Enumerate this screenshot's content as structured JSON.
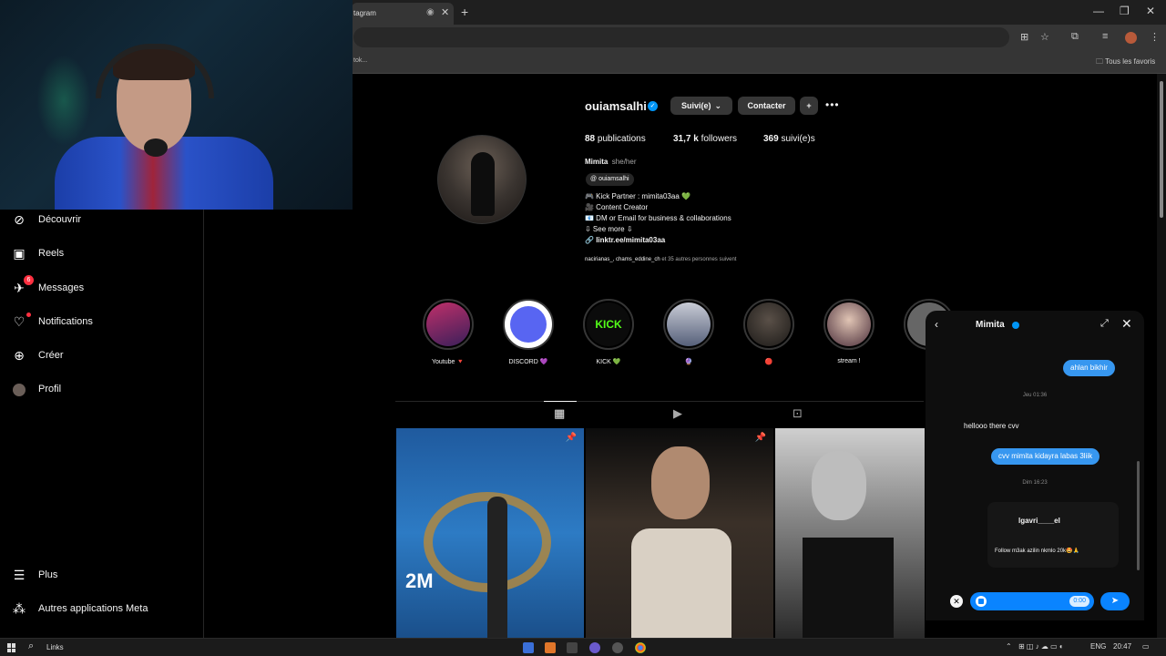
{
  "browser": {
    "tab_title": "tagram",
    "bookmark_left": "tok...",
    "bookmarks_folder": "Tous les favoris"
  },
  "sidebar": {
    "items": [
      {
        "label": "Découvrir",
        "icon": "compass-icon"
      },
      {
        "label": "Reels",
        "icon": "reels-icon"
      },
      {
        "label": "Messages",
        "icon": "messenger-icon",
        "badge": "6"
      },
      {
        "label": "Notifications",
        "icon": "heart-icon"
      },
      {
        "label": "Créer",
        "icon": "plus-square-icon"
      },
      {
        "label": "Profil",
        "icon": "avatar-icon"
      }
    ],
    "more": "Plus",
    "meta_apps": "Autres applications Meta"
  },
  "profile": {
    "username": "ouiamsalhi",
    "follow_btn": "Suivi(e)",
    "contact_btn": "Contacter",
    "posts_count": "88",
    "posts_label": "publications",
    "followers_count": "31,7 k",
    "followers_label": "followers",
    "following_count": "369",
    "following_label": "suivi(e)s",
    "display_name": "Mimita",
    "pronouns": "she/her",
    "threads_handle": "ouiamsalhi",
    "bio_lines": [
      "🎮 Kick Partner : mimita03aa 💚",
      "🎥 Content Creator",
      "📧 DM or Email for business & collaborations",
      "⇩ See more ⇩"
    ],
    "link": "linktr.ee/mimita03aa",
    "followed_by_names": "nacirianas_, chams_eddine_ch",
    "followed_by_suffix": " et 35 autres personnes suivent"
  },
  "highlights": [
    {
      "label": "Youtube 🔻",
      "color": "#8a1f4a"
    },
    {
      "label": "DISCORD 💜",
      "color": "#5865f2"
    },
    {
      "label": "KICK 💚",
      "color": "#111"
    },
    {
      "label": "🔮",
      "color": "#2e3c55"
    },
    {
      "label": "🔴",
      "color": "#3a3632"
    },
    {
      "label": "stream !",
      "color": "#4a2e3a"
    }
  ],
  "dm": {
    "title": "Mimita",
    "messages": {
      "out1": "ahlan bikhir",
      "ts1": "Jeu 01:36",
      "in1": "hellooo there cvv",
      "out2": "cvv mimita kidayra labas 3liik",
      "ts2": "Dim 16:23"
    },
    "share_user": "lgavri____el",
    "share_caption": "Follow m3ak azilin nkmlo 20k🤩🙏",
    "rec_timer": "0:00"
  },
  "taskbar": {
    "search": "Links",
    "lang": "ENG",
    "time": "20:47"
  }
}
